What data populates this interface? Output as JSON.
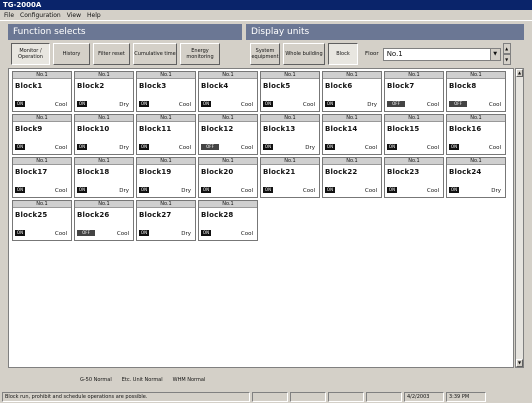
{
  "window": {
    "title": "TG-2000A"
  },
  "menu": [
    "File",
    "Configuration",
    "View",
    "Help"
  ],
  "function_selects": {
    "heading": "Function selects",
    "tabs": [
      {
        "label": "Monitor / Operation",
        "active": true
      },
      {
        "label": "History",
        "active": false
      },
      {
        "label": "Filter reset",
        "active": false
      },
      {
        "label": "Cumulative time",
        "active": false
      },
      {
        "label": "Energy monitoring",
        "active": false
      }
    ]
  },
  "display_units": {
    "heading": "Display units",
    "tabs": [
      {
        "label": "System equipment",
        "active": false
      },
      {
        "label": "Whole building",
        "active": false
      },
      {
        "label": "Block",
        "active": true
      }
    ],
    "floor_label": "Floor",
    "floor_value": "No.1"
  },
  "blocks": [
    {
      "header": "No.1",
      "name": "Block1",
      "status": "ON",
      "mode": "Cool"
    },
    {
      "header": "No.1",
      "name": "Block2",
      "status": "ON",
      "mode": "Dry"
    },
    {
      "header": "No.1",
      "name": "Block3",
      "status": "ON",
      "mode": "Cool"
    },
    {
      "header": "No.1",
      "name": "Block4",
      "status": "ON",
      "mode": "Cool"
    },
    {
      "header": "No.1",
      "name": "Block5",
      "status": "ON",
      "mode": "Cool"
    },
    {
      "header": "No.1",
      "name": "Block6",
      "status": "ON",
      "mode": "Dry"
    },
    {
      "header": "No.1",
      "name": "Block7",
      "status": "OFF",
      "mode": "Cool"
    },
    {
      "header": "No.1",
      "name": "Block8",
      "status": "OFF",
      "mode": "Cool"
    },
    {
      "header": "No.1",
      "name": "Block9",
      "status": "ON",
      "mode": "Cool"
    },
    {
      "header": "No.1",
      "name": "Block10",
      "status": "ON",
      "mode": "Dry"
    },
    {
      "header": "No.1",
      "name": "Block11",
      "status": "ON",
      "mode": "Cool"
    },
    {
      "header": "No.1",
      "name": "Block12",
      "status": "OFF",
      "mode": "Cool"
    },
    {
      "header": "No.1",
      "name": "Block13",
      "status": "ON",
      "mode": "Dry"
    },
    {
      "header": "No.1",
      "name": "Block14",
      "status": "ON",
      "mode": "Cool"
    },
    {
      "header": "No.1",
      "name": "Block15",
      "status": "ON",
      "mode": "Cool"
    },
    {
      "header": "No.1",
      "name": "Block16",
      "status": "ON",
      "mode": "Cool"
    },
    {
      "header": "No.1",
      "name": "Block17",
      "status": "ON",
      "mode": "Cool"
    },
    {
      "header": "No.1",
      "name": "Block18",
      "status": "ON",
      "mode": "Dry"
    },
    {
      "header": "No.1",
      "name": "Block19",
      "status": "ON",
      "mode": "Dry"
    },
    {
      "header": "No.1",
      "name": "Block20",
      "status": "ON",
      "mode": "Cool"
    },
    {
      "header": "No.1",
      "name": "Block21",
      "status": "ON",
      "mode": "Cool"
    },
    {
      "header": "No.1",
      "name": "Block22",
      "status": "ON",
      "mode": "Cool"
    },
    {
      "header": "No.1",
      "name": "Block23",
      "status": "ON",
      "mode": "Cool"
    },
    {
      "header": "No.1",
      "name": "Block24",
      "status": "ON",
      "mode": "Dry"
    },
    {
      "header": "No.1",
      "name": "Block25",
      "status": "ON",
      "mode": "Cool"
    },
    {
      "header": "No.1",
      "name": "Block26",
      "status": "OFF",
      "mode": "Cool"
    },
    {
      "header": "No.1",
      "name": "Block27",
      "status": "ON",
      "mode": "Dry"
    },
    {
      "header": "No.1",
      "name": "Block28",
      "status": "ON",
      "mode": "Cool"
    }
  ],
  "status_line": [
    "G-50 Normal",
    "Etc. Unit Normal",
    "WHM Normal"
  ],
  "statusbar": {
    "message": "Block run, prohibit and schedule operations are possible.",
    "date": "4/2/2003",
    "time": "3:39 PM"
  },
  "colors": {
    "section_head": "#6b7794",
    "title_bar": "#0a246a",
    "status_on": "#111111"
  }
}
